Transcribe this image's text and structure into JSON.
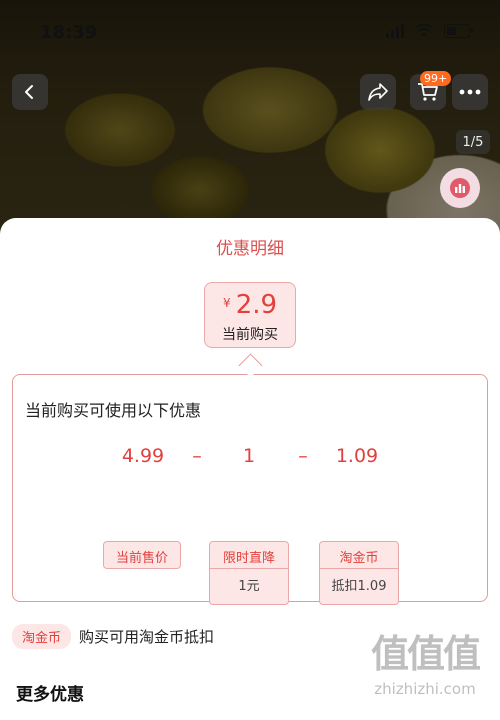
{
  "status": {
    "time": "18:39"
  },
  "header": {
    "back_icon": "chevron-left-icon",
    "share_icon": "share-icon",
    "cart_icon": "cart-icon",
    "cart_badge": "99+",
    "more_icon": "more-dots-icon",
    "page_counter": "1/5",
    "chart_icon": "bar-chart-icon"
  },
  "sheet": {
    "title": "优惠明细",
    "price": {
      "currency": "¥",
      "value": "2.9",
      "label": "当前购买"
    },
    "promo": {
      "heading": "当前购买可使用以下优惠",
      "calc": {
        "base": "4.99",
        "minus1": "1",
        "minus2": "1.09",
        "op": "–"
      },
      "tags": [
        {
          "title": "当前售价"
        },
        {
          "title": "限时直降",
          "sub": "1元"
        },
        {
          "title": "淘金币",
          "sub": "抵扣1.09"
        }
      ]
    },
    "coin": {
      "tag": "淘金币",
      "text": "购买可用淘金币抵扣"
    },
    "more_title": "更多优惠"
  },
  "watermark": {
    "logo": "值值值",
    "url": "zhizhizhi.com"
  },
  "colors": {
    "accent": "#e1413d",
    "tag_bg": "#fde6e6",
    "tag_border": "#e9a9a9",
    "badge": "#ff6a1f"
  }
}
